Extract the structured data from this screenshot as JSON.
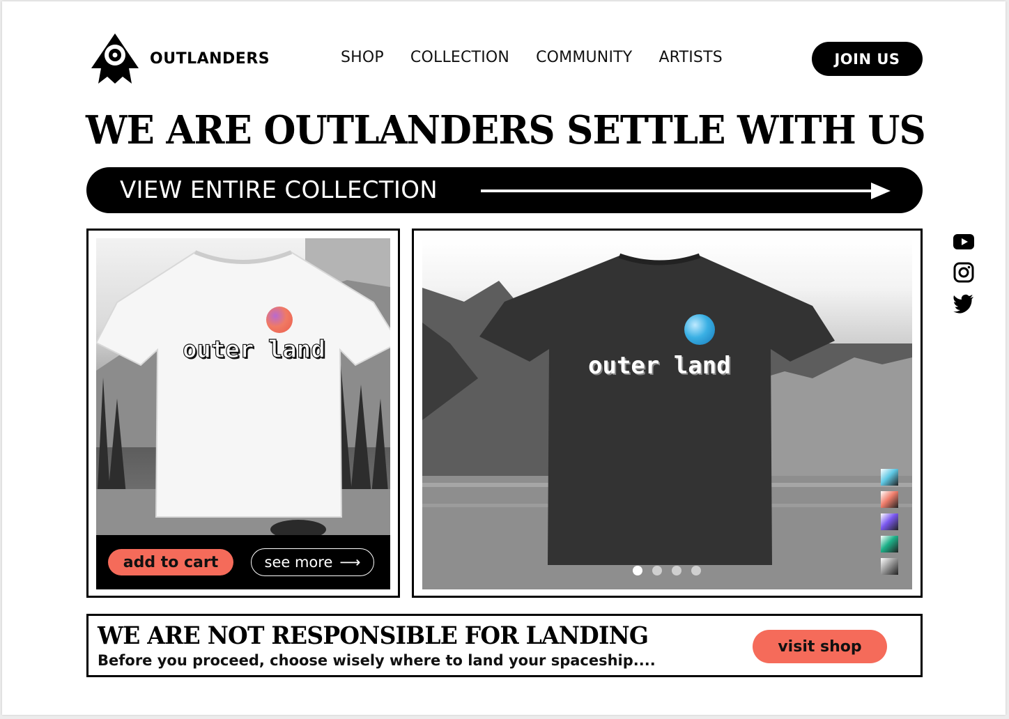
{
  "brand": {
    "name": "OUTLANDERS",
    "logo_icon": "alien-rocket-icon"
  },
  "nav": {
    "items": [
      {
        "label": "SHOP"
      },
      {
        "label": "COLLECTION"
      },
      {
        "label": "COMMUNITY"
      },
      {
        "label": "ARTISTS"
      }
    ],
    "cta_label": "JOIN US"
  },
  "hero": {
    "title": "WE ARE  OUTLANDERS SETTLE WITH US",
    "view_collection_label": "VIEW ENTIRE COLLECTION"
  },
  "product_left": {
    "tee_print": "outer land",
    "add_to_cart_label": "add to cart",
    "see_more_label": "see more",
    "see_more_icon": "arrow-right-icon"
  },
  "product_right": {
    "tee_print": "outer land",
    "carousel_pages": 4,
    "carousel_active_index": 0,
    "swatches": [
      {
        "name": "swatch-cyan-marble",
        "color": "#5fc8e4"
      },
      {
        "name": "swatch-coral-marble",
        "color": "#ef7d6b"
      },
      {
        "name": "swatch-violet-marble",
        "color": "#7a58ef"
      },
      {
        "name": "swatch-green-marble",
        "color": "#1db088"
      },
      {
        "name": "swatch-grey-marble",
        "color": "#9a9a9a"
      }
    ]
  },
  "socials": [
    {
      "name": "youtube-icon"
    },
    {
      "name": "instagram-icon"
    },
    {
      "name": "twitter-icon"
    }
  ],
  "banner": {
    "title": "WE ARE NOT RESPONSIBLE FOR  LANDING",
    "subtitle": "Before you proceed, choose wisely where to land your spaceship....",
    "visit_label": "visit shop"
  },
  "colors": {
    "accent": "#f56b5a",
    "ink": "#000000",
    "paper": "#ffffff"
  }
}
